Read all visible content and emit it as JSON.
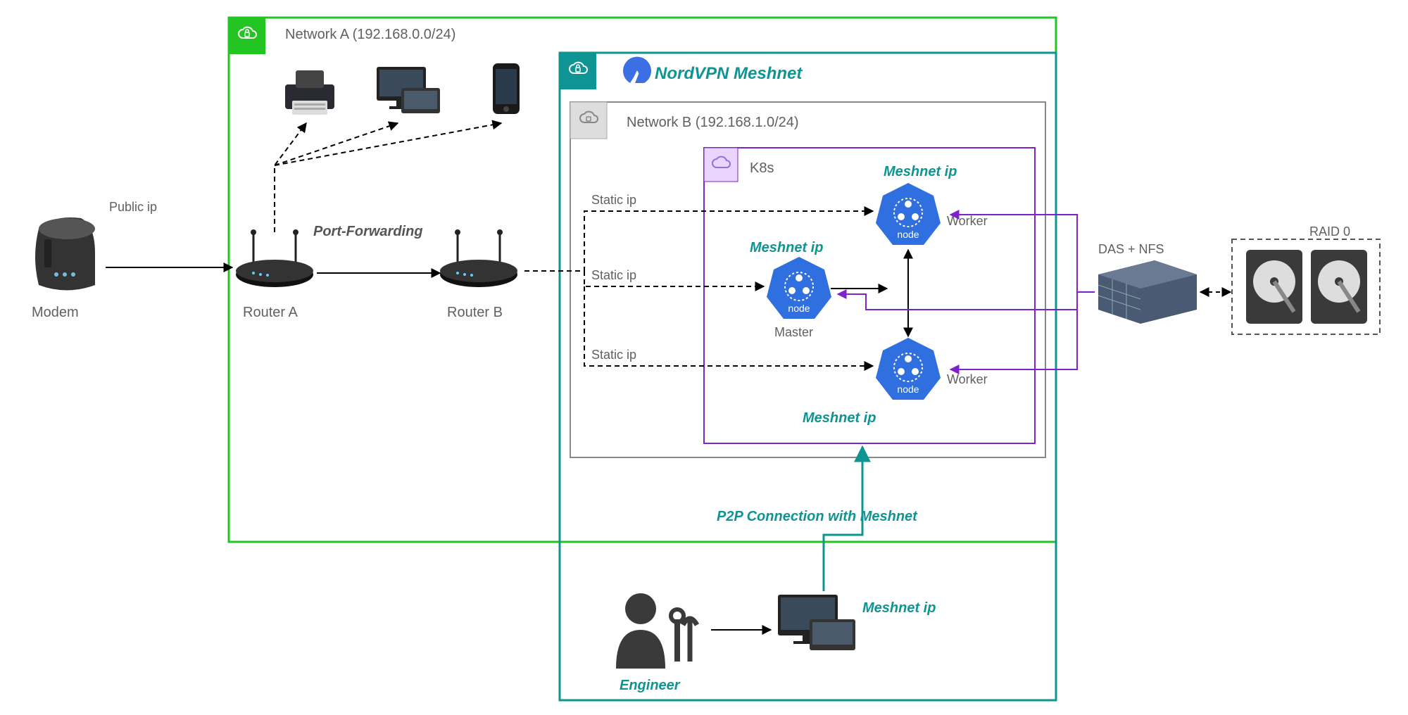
{
  "diagram": {
    "networkA": {
      "title": "Network A (192.168.0.0/24)"
    },
    "meshnet": {
      "title": "NordVPN Meshnet"
    },
    "networkB": {
      "title": "Network B (192.168.1.0/24)"
    },
    "k8s": {
      "title": "K8s",
      "master": "Master",
      "worker1": "Worker",
      "worker2": "Worker",
      "nodeLabel": "node"
    },
    "modem": "Modem",
    "routerA": "Router A",
    "routerB": "Router B",
    "publicIp": "Public ip",
    "portForwarding": "Port-Forwarding",
    "staticIp": "Static ip",
    "meshnetIp": "Meshnet ip",
    "storage": {
      "dasNfs": "DAS + NFS",
      "raid0": "RAID 0"
    },
    "engineer": "Engineer",
    "p2p": "P2P Connection with Meshnet"
  }
}
